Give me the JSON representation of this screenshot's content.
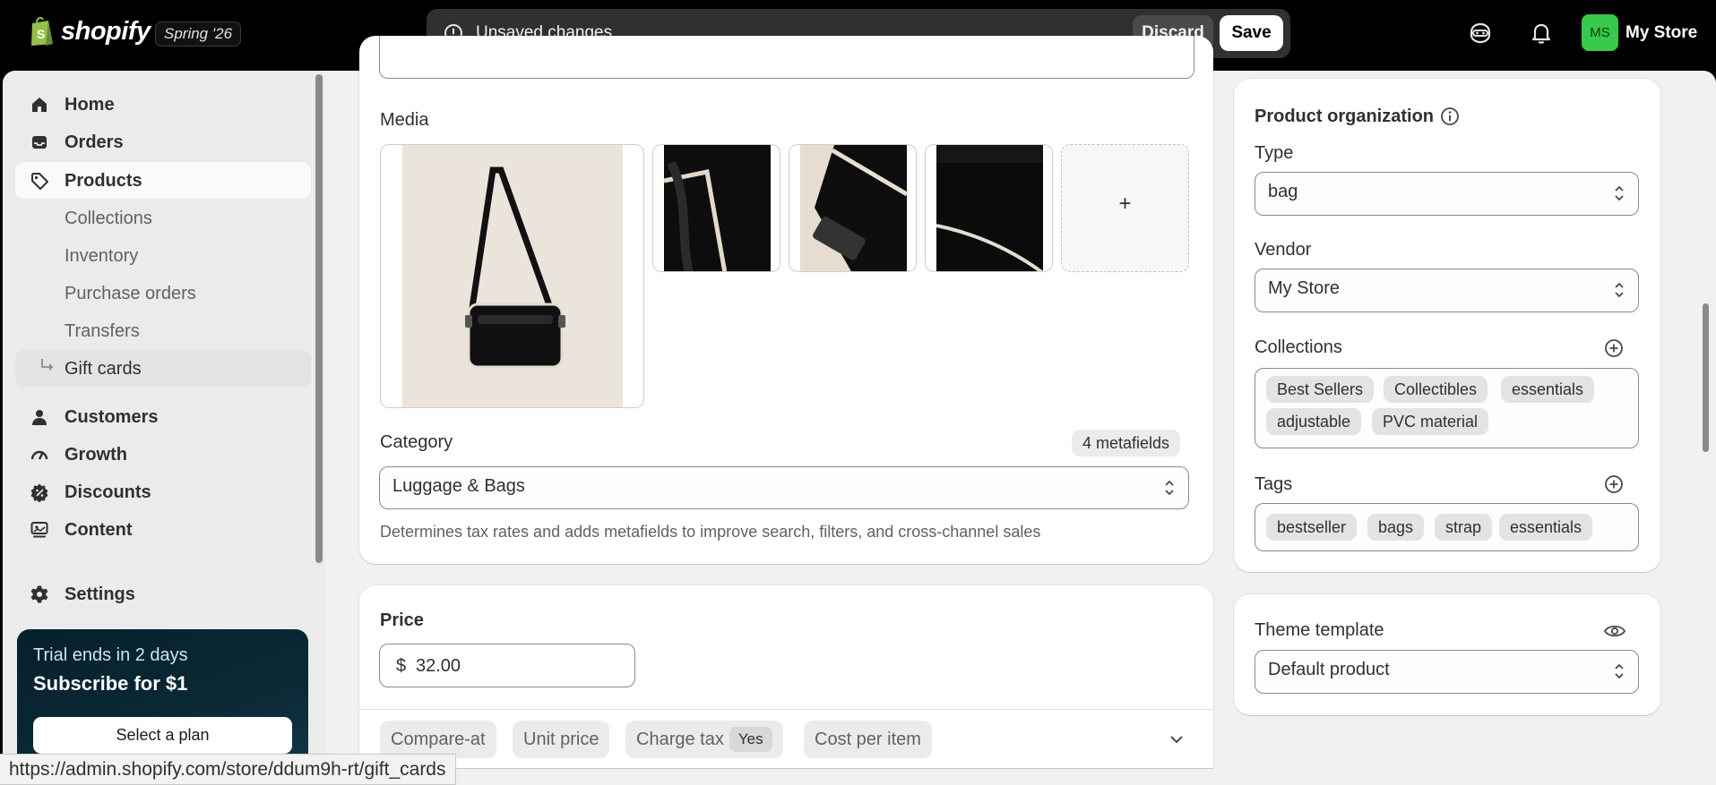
{
  "topbar": {
    "brand": "shopify",
    "edition": "Spring '26",
    "unsaved_text": "Unsaved changes",
    "discard_label": "Discard",
    "save_label": "Save",
    "store_initials": "MS",
    "store_name": "My Store",
    "icons": [
      "sidekick-icon",
      "bell-icon"
    ]
  },
  "sidebar": {
    "items": [
      {
        "label": "Home",
        "icon": "home-icon"
      },
      {
        "label": "Orders",
        "icon": "inbox-icon"
      },
      {
        "label": "Products",
        "icon": "tag-icon",
        "active": true
      },
      {
        "label": "Collections"
      },
      {
        "label": "Inventory"
      },
      {
        "label": "Purchase orders"
      },
      {
        "label": "Transfers"
      },
      {
        "label": "Gift cards",
        "hovered": true
      },
      {
        "label": "Customers",
        "icon": "person-icon"
      },
      {
        "label": "Growth",
        "icon": "gauge-icon"
      },
      {
        "label": "Discounts",
        "icon": "discount-icon"
      },
      {
        "label": "Content",
        "icon": "content-icon"
      },
      {
        "label": "Settings",
        "icon": "gear-icon"
      }
    ],
    "trial": {
      "line1": "Trial ends in 2 days",
      "line2": "Subscribe for $1",
      "button": "Select a plan"
    }
  },
  "media": {
    "title": "Media",
    "add_label": "+"
  },
  "category": {
    "title": "Category",
    "metafields": "4 metafields",
    "value": "Luggage & Bags",
    "help": "Determines tax rates and adds metafields to improve search, filters, and cross-channel sales"
  },
  "price": {
    "title": "Price",
    "currency": "$",
    "amount": "32.00",
    "pills": {
      "compare_at": "Compare-at",
      "unit_price": "Unit price",
      "charge_tax": "Charge tax",
      "charge_tax_value": "Yes",
      "cost_per_item": "Cost per item"
    }
  },
  "organization": {
    "title": "Product organization",
    "type_label": "Type",
    "type_value": "bag",
    "vendor_label": "Vendor",
    "vendor_value": "My Store",
    "collections_label": "Collections",
    "collections": [
      "Best Sellers",
      "Collectibles",
      "essentials",
      "adjustable",
      "PVC material"
    ],
    "tags_label": "Tags",
    "tags": [
      "bestseller",
      "bags",
      "strap",
      "essentials"
    ]
  },
  "theme": {
    "title": "Theme template",
    "value": "Default product"
  },
  "statusbar": {
    "url": "https://admin.shopify.com/store/ddum9h-rt/gift_cards"
  }
}
